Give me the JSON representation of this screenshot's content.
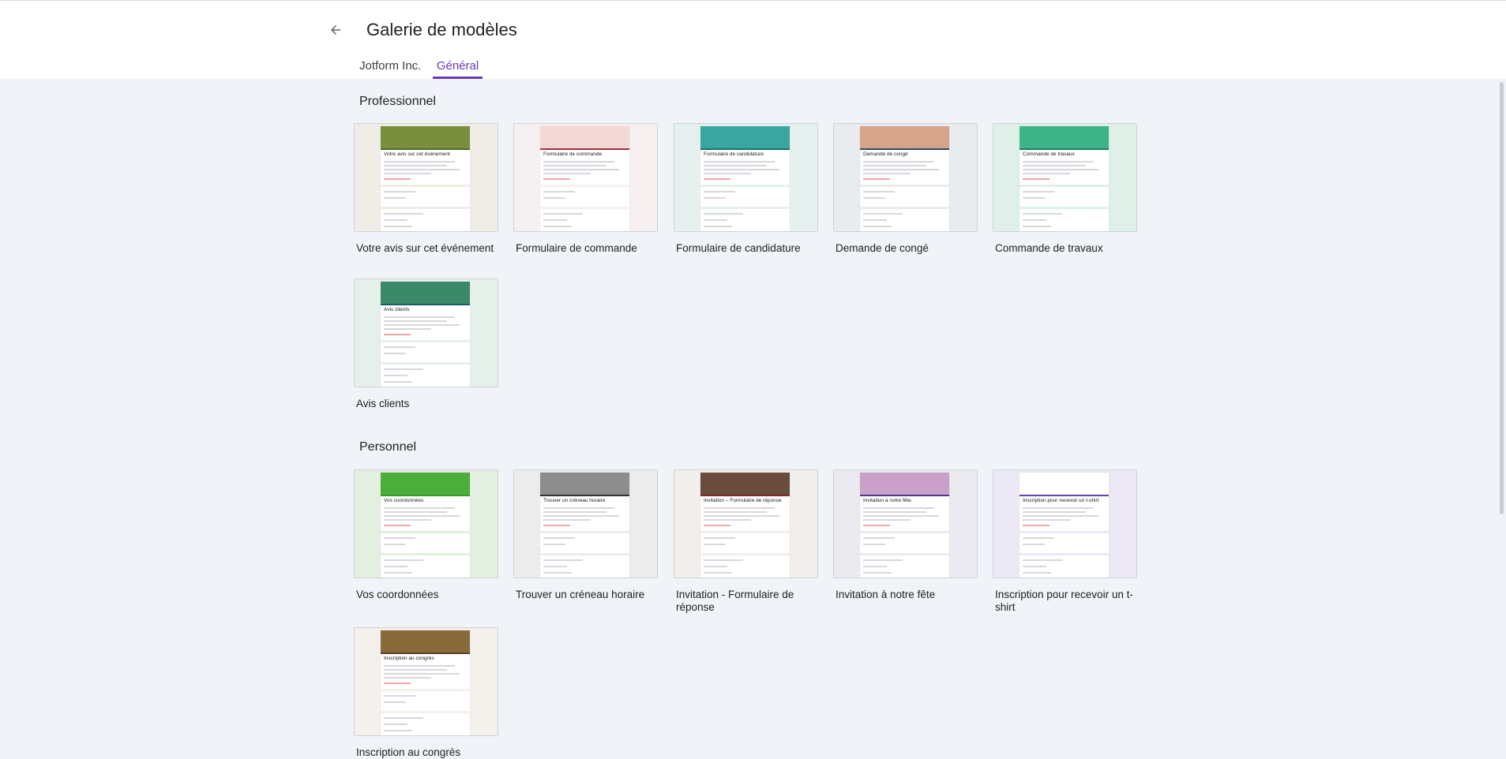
{
  "header": {
    "title": "Galerie de modèles",
    "back_icon": "arrow-back-icon"
  },
  "tabs": [
    {
      "label": "Jotform Inc.",
      "active": false
    },
    {
      "label": "Général",
      "active": true
    }
  ],
  "sections": {
    "professionnel": {
      "title": "Professionnel",
      "templates": [
        {
          "label": "Votre avis sur cet événement",
          "form_title": "Votre avis sur cet événement",
          "bg": "#efede6",
          "accent": "#4d6b2e",
          "banner": "#7a8f3d"
        },
        {
          "label": "Formulaire de commande",
          "form_title": "Formulaire de commande",
          "bg": "#f6f0f0",
          "accent": "#a3303a",
          "banner": "#f3d8d6"
        },
        {
          "label": "Formulaire de candidature",
          "form_title": "Formulaire de candidature",
          "bg": "#e6f0ef",
          "accent": "#1d6f6a",
          "banner": "#3aa6a0"
        },
        {
          "label": "Demande de congé",
          "form_title": "Demande de congé",
          "bg": "#e8ecee",
          "accent": "#2d4a6b",
          "banner": "#d7a48a"
        },
        {
          "label": "Commande de travaux",
          "form_title": "Commande de travaux",
          "bg": "#dff0e8",
          "accent": "#1a7f60",
          "banner": "#3fb48a"
        }
      ],
      "templates_row2": [
        {
          "label": "Avis clients",
          "form_title": "Avis clients",
          "bg": "#e6f0ea",
          "accent": "#1c5d6b",
          "banner": "#3a8a6a"
        }
      ]
    },
    "personnel": {
      "title": "Personnel",
      "templates": [
        {
          "label": "Vos coordonnées",
          "form_title": "Vos coordonnées",
          "bg": "#e3efdf",
          "accent": "#3a9a2a",
          "banner": "#4cae3a"
        },
        {
          "label": "Trouver un créneau horaire",
          "form_title": "Trouver un créneau horaire",
          "bg": "#ececec",
          "accent": "#333333",
          "banner": "#8d8d8d"
        },
        {
          "label": "Invitation - Formulaire de réponse",
          "form_title": "Invitation – Formulaire de réponse",
          "bg": "#f1eeec",
          "accent": "#7d2a2a",
          "banner": "#6a4c3c"
        },
        {
          "label": "Invitation à notre fête",
          "form_title": "Invitation à notre fête",
          "bg": "#ebeaf0",
          "accent": "#4d3a8a",
          "banner": "#c9a0c8"
        },
        {
          "label": "Inscription pour recevoir un t-shirt",
          "form_title": "Inscription pour recevoir un t-shirt",
          "bg": "#ede8f5",
          "accent": "#6a3db0",
          "banner": "#ffffff"
        }
      ],
      "templates_row2": [
        {
          "label": "Inscription au congrès",
          "form_title": "Inscription au congrès",
          "bg": "#f4f1ec",
          "accent": "#5a4020",
          "banner": "#8a6a3a"
        }
      ]
    }
  }
}
